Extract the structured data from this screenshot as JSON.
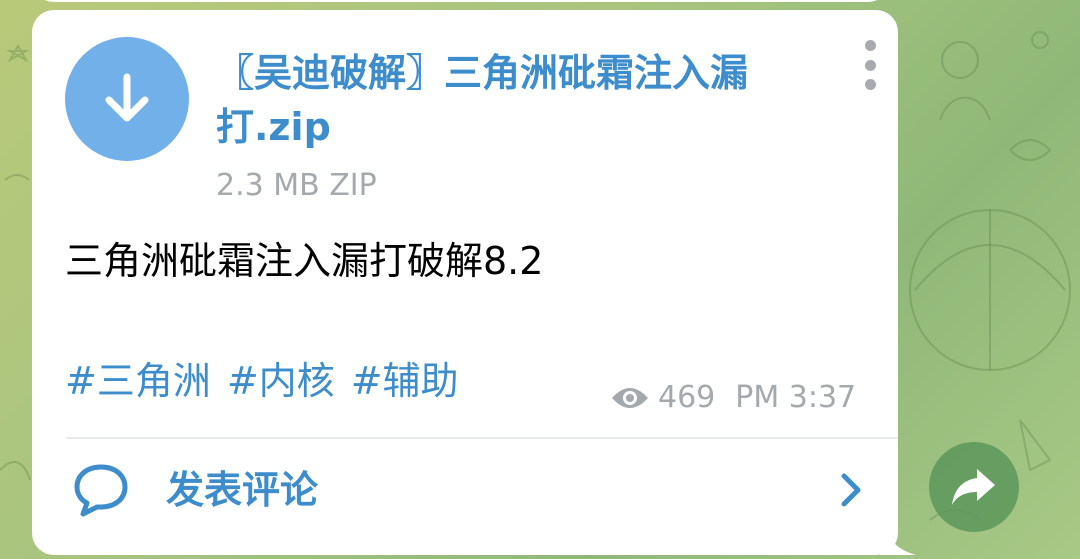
{
  "file": {
    "name": "〖吴迪破解〗三角洲砒霜注入漏打.zip",
    "size_and_type": "2.3 MB ZIP"
  },
  "message": {
    "text": "三角洲砒霜注入漏打破解8.2",
    "hashtags": [
      "#三角洲",
      "#内核",
      "#辅助"
    ],
    "views": "469",
    "time": "PM 3:37"
  },
  "comments": {
    "label": "发表评论"
  },
  "icons": {
    "download": "download-arrow-icon",
    "menu": "more-vertical-icon",
    "views": "eye-icon",
    "comment": "speech-bubble-icon",
    "open": "chevron-right-icon",
    "share": "share-arrow-icon"
  },
  "colors": {
    "accent": "#3d8ccc",
    "download_circle": "#72b0ea",
    "meta_gray": "#a4a9ae",
    "share_button": "#5c965a"
  }
}
